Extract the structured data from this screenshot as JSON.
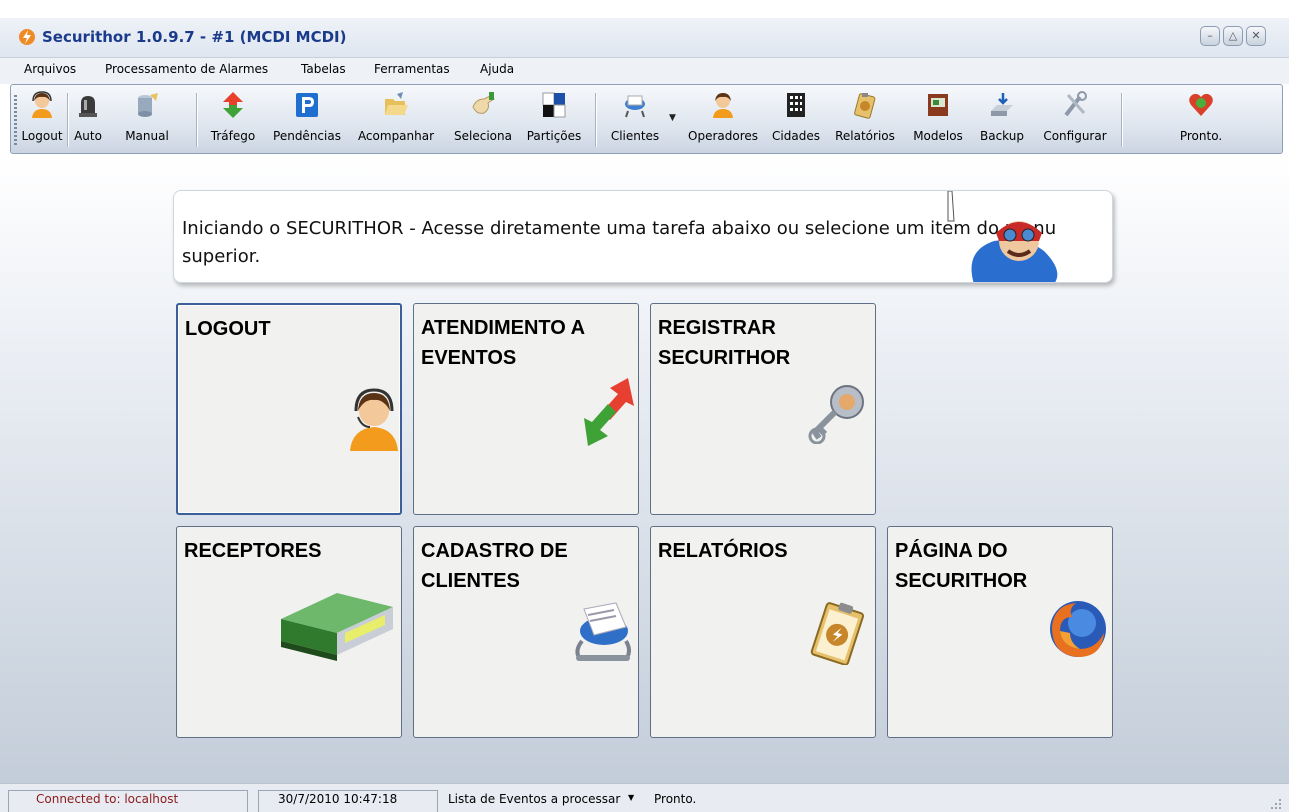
{
  "window": {
    "title": "Securithor 1.0.9.7  -  #1 (MCDI MCDI)",
    "controls": [
      "minimize",
      "maximize",
      "close"
    ]
  },
  "menu": [
    "Arquivos",
    "Processamento de Alarmes",
    "Tabelas",
    "Ferramentas",
    "Ajuda"
  ],
  "toolbar": {
    "buttons": [
      {
        "label": "Logout",
        "icon": "operator-headset-icon"
      },
      {
        "label": "Auto",
        "icon": "siren-icon"
      },
      {
        "label": "Manual",
        "icon": "database-icon"
      },
      {
        "label": "Tráfego",
        "icon": "traffic-arrows-icon"
      },
      {
        "label": "Pendências",
        "icon": "parking-p-icon"
      },
      {
        "label": "Acompanhar",
        "icon": "folder-open-icon"
      },
      {
        "label": "Seleciona",
        "icon": "hand-icon"
      },
      {
        "label": "Partições",
        "icon": "partitions-icon"
      },
      {
        "label": "Clientes",
        "icon": "rolodex-icon"
      },
      {
        "label": "Operadores",
        "icon": "operator-icon"
      },
      {
        "label": "Cidades",
        "icon": "building-icon"
      },
      {
        "label": "Relatórios",
        "icon": "clipboard-icon"
      },
      {
        "label": "Modelos",
        "icon": "book-icon"
      },
      {
        "label": "Backup",
        "icon": "backup-drive-icon"
      },
      {
        "label": "Configurar",
        "icon": "tools-icon"
      }
    ],
    "status_label": "Pronto."
  },
  "banner": {
    "text": "Iniciando o SECURITHOR - Acesse diretamente uma tarefa abaixo ou selecione um item do menu superior."
  },
  "tiles": [
    {
      "title": "LOGOUT",
      "icon": "operator-headset-icon"
    },
    {
      "title": "ATENDIMENTO A EVENTOS",
      "icon": "traffic-arrows-icon"
    },
    {
      "title": "REGISTRAR SECURITHOR",
      "icon": "key-icon"
    },
    {
      "title": "RECEPTORES",
      "icon": "receiver-device-icon"
    },
    {
      "title": "CADASTRO DE CLIENTES",
      "icon": "rolodex-icon"
    },
    {
      "title": "RELATÓRIOS",
      "icon": "clipboard-icon"
    },
    {
      "title": "PÁGINA DO SECURITHOR",
      "icon": "firefox-icon"
    }
  ],
  "statusbar": {
    "connection": "Connected to: localhost",
    "datetime": "30/7/2010 10:47:18",
    "events_dropdown": "Lista de Eventos a processar",
    "status": "Pronto."
  },
  "colors": {
    "title_text": "#1a3a8a",
    "connection_text": "#8b1a1a",
    "tile_bg": "#f1f1ef"
  }
}
